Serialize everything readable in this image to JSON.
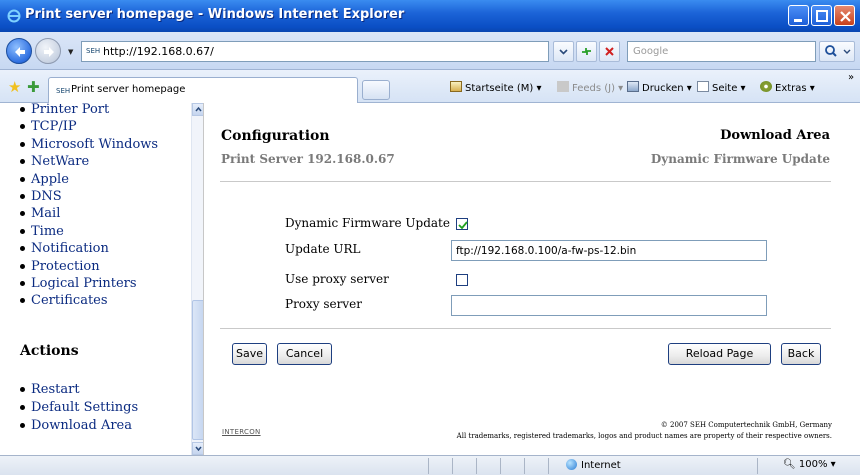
{
  "window": {
    "title": "Print server homepage - Windows Internet Explorer"
  },
  "address_bar": {
    "favicon_text": "SEH",
    "url": "http://192.168.0.67/",
    "search_placeholder": "Google"
  },
  "tabs_bar": {
    "tab_label": "Print server homepage",
    "commands": {
      "home": "Startseite (M)",
      "feeds": "Feeds (J)",
      "print": "Drucken",
      "page": "Seite",
      "tools": "Extras"
    }
  },
  "sidebar": {
    "nav_items": [
      "Printer Port",
      "TCP/IP",
      "Microsoft Windows",
      "NetWare",
      "Apple",
      "DNS",
      "Mail",
      "Time",
      "Notification",
      "Protection",
      "Logical Printers",
      "Certificates"
    ],
    "actions_title": "Actions",
    "action_items": [
      "Restart",
      "Default Settings",
      "Download Area"
    ]
  },
  "content": {
    "title": "Configuration",
    "subtitle": "Print Server 192.168.0.67",
    "area_title": "Download Area",
    "area_subtitle": "Dynamic Firmware Update",
    "form": {
      "dynamic_update_label": "Dynamic Firmware Update",
      "dynamic_update_checked": true,
      "update_url_label": "Update URL",
      "update_url_value": "ftp://192.168.0.100/a-fw-ps-12.bin",
      "use_proxy_label": "Use proxy server",
      "use_proxy_checked": false,
      "proxy_server_label": "Proxy server",
      "proxy_server_value": ""
    },
    "buttons": {
      "save": "Save",
      "cancel": "Cancel",
      "reload": "Reload Page",
      "back": "Back"
    },
    "footer": {
      "logo_text": "INTERCON",
      "copyright_line1": "© 2007 SEH Computertechnik GmbH, Germany",
      "copyright_line2": "All trademarks, registered trademarks, logos and product names are property of their respective owners."
    }
  },
  "status_bar": {
    "zone": "Internet",
    "zoom": "100%"
  }
}
